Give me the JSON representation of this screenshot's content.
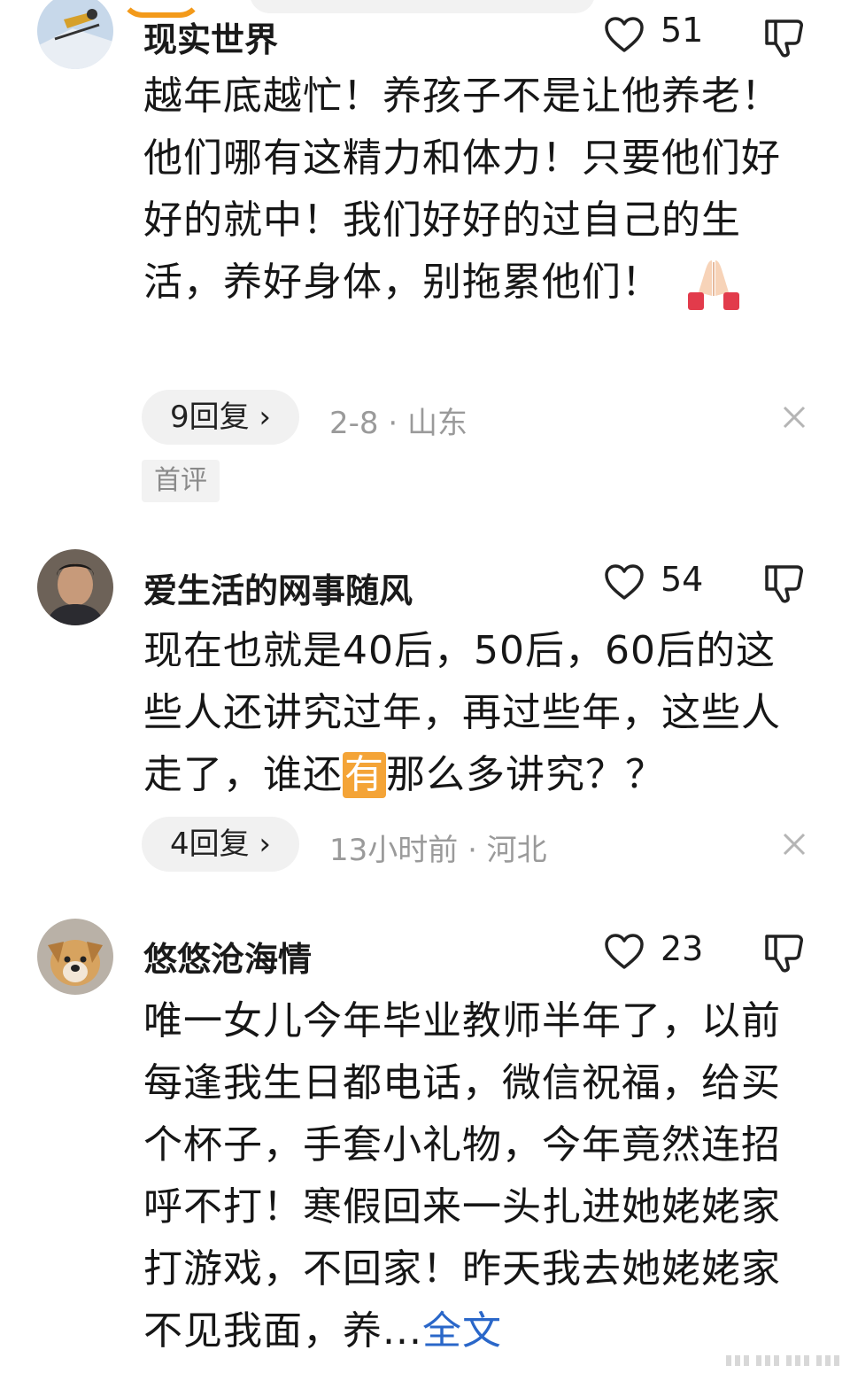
{
  "comments": [
    {
      "username": "现实世界",
      "likes": "51",
      "body": "越年底越忙！养孩子不是让他养老！他们哪有这精力和体力！只要他们好好的就中！我们好好的过自己的生活，养好身体，别拖累他们！",
      "emoji": "folded-hands-emoji",
      "replies": "9回复 ›",
      "meta": "2-8 · 山东",
      "tag": "首评"
    },
    {
      "username": "爱生活的网事随风",
      "likes": "54",
      "body_before": "现在也就是40后，50后，60后的这些人还讲究过年，再过些年，这些人走了，谁还",
      "body_highlight": "有",
      "body_after": "那么多讲究？？",
      "replies": "4回复 ›",
      "meta": "13小时前 · 河北"
    },
    {
      "username": "悠悠沧海情",
      "likes": "23",
      "body": "唯一女儿今年毕业教师半年了，以前每逢我生日都电话，微信祝福，给买个杯子，手套小礼物，今年竟然连招呼不打！寒假回来一头扎进她姥姥家打游戏，不回家！昨天我去她姥姥家不见我面，养...",
      "more": "全文"
    }
  ],
  "colors": {
    "link": "#2a67c9",
    "highlight": "#f4a437",
    "meta": "#9a9a9a"
  }
}
